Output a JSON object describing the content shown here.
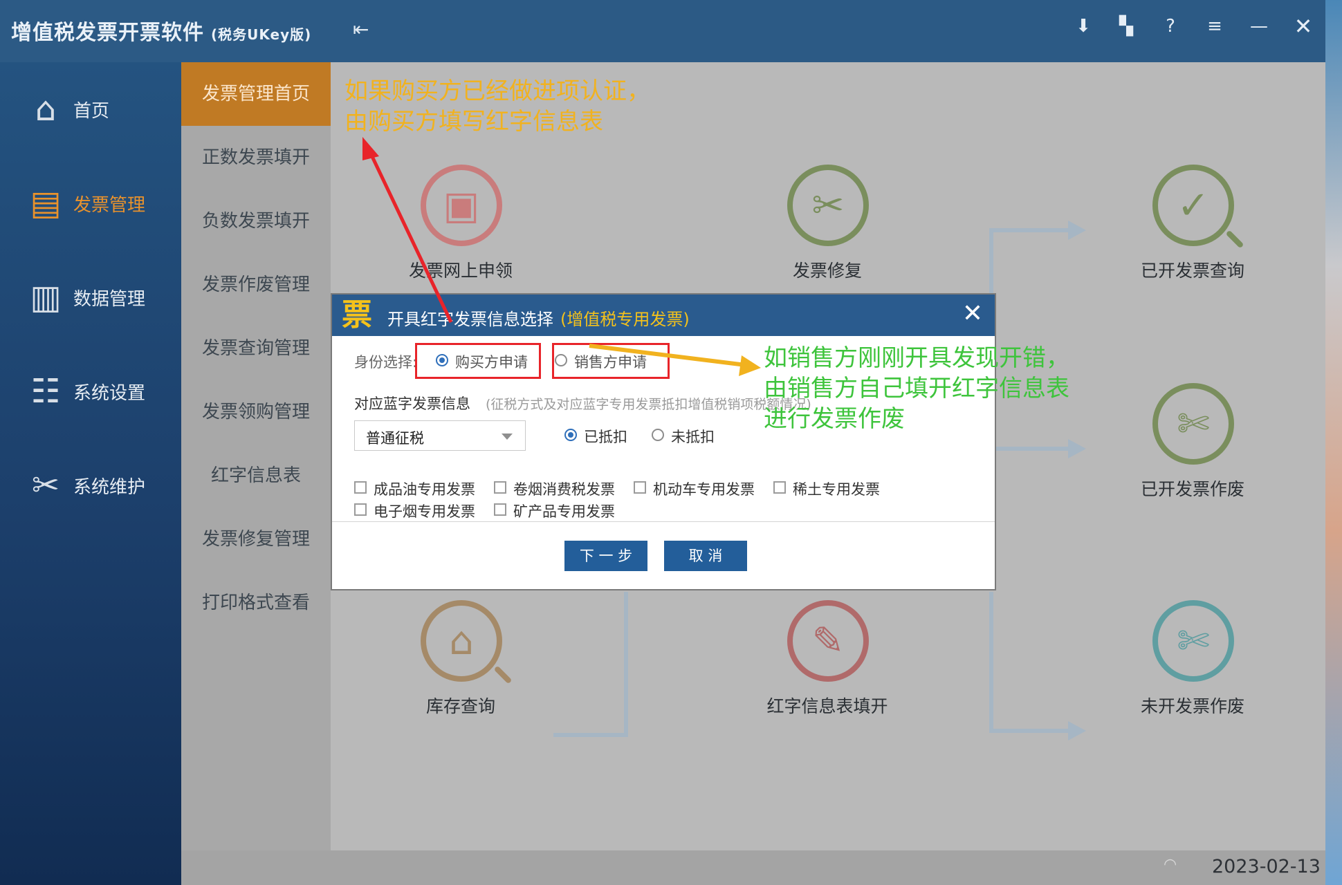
{
  "app": {
    "title": "增值税发票开票软件",
    "edition": "(税务UKey版)"
  },
  "toolbar_icons": [
    "download-icon",
    "bookmark-icon",
    "help-icon",
    "menu-icon",
    "minimize-icon",
    "close-icon"
  ],
  "nav": {
    "items": [
      {
        "label": "首页",
        "icon": "home-icon"
      },
      {
        "label": "发票管理",
        "icon": "printer-icon"
      },
      {
        "label": "数据管理",
        "icon": "data-icon"
      },
      {
        "label": "系统设置",
        "icon": "sliders-icon"
      },
      {
        "label": "系统维护",
        "icon": "tools-icon"
      }
    ],
    "active": "发票管理"
  },
  "subnav": {
    "items": [
      "发票管理首页",
      "正数发票填开",
      "负数发票填开",
      "发票作废管理",
      "发票查询管理",
      "发票领购管理",
      "红字信息表",
      "发票修复管理",
      "打印格式查看"
    ],
    "active": "发票管理首页"
  },
  "tiles": [
    {
      "label": "发票网上申领",
      "icon": "monitor-icon",
      "color": "#c97c7c"
    },
    {
      "label": "发票修复",
      "icon": "tools-icon",
      "color": "#7a8e5d"
    },
    {
      "label": "已开发票查询",
      "icon": "checklist-search-icon",
      "color": "#7a8e5d"
    },
    {
      "label": "已开发票作废",
      "icon": "cut-invoice-icon",
      "color": "#7a8e5d"
    },
    {
      "label": "库存查询",
      "icon": "warehouse-search-icon",
      "color": "#a58a68"
    },
    {
      "label": "红字信息表填开",
      "icon": "clipboard-pen-icon",
      "color": "#b06a6a"
    },
    {
      "label": "未开发票作废",
      "icon": "cut-invoice-icon",
      "color": "#5f9ea1"
    }
  ],
  "annotations": {
    "orange_line1": "如果购买方已经做进项认证，",
    "orange_line2": "由购买方填写红字信息表",
    "green_line1": "如销售方刚刚开具发现开错，",
    "green_line2": "由销售方自己填开红字信息表",
    "green_line3": "进行发票作废",
    "orange_color": "#f1b21f",
    "green_color": "#3ec43c",
    "red_color": "#e8242a"
  },
  "dialog": {
    "logo": "票",
    "title": "开具红字发票信息选择",
    "subtitle": "(增值税专用发票)",
    "identity_label": "身份选择:",
    "identity_options": [
      "购买方申请",
      "销售方申请"
    ],
    "identity_selected": "购买方申请",
    "blue_invoice_label": "对应蓝字发票信息",
    "blue_invoice_hint": "(征税方式及对应蓝字专用发票抵扣增值税销项税额情况)",
    "tax_method": "普通征税",
    "deduct_options": [
      "已抵扣",
      "未抵扣"
    ],
    "deduct_selected": "已抵扣",
    "special_types": [
      "成品油专用发票",
      "卷烟消费税发票",
      "机动车专用发票",
      "稀土专用发票",
      "电子烟专用发票",
      "矿产品专用发票"
    ],
    "next_button": "下 一 步",
    "cancel_button": "取  消"
  },
  "status": {
    "date": "2023-02-13"
  }
}
